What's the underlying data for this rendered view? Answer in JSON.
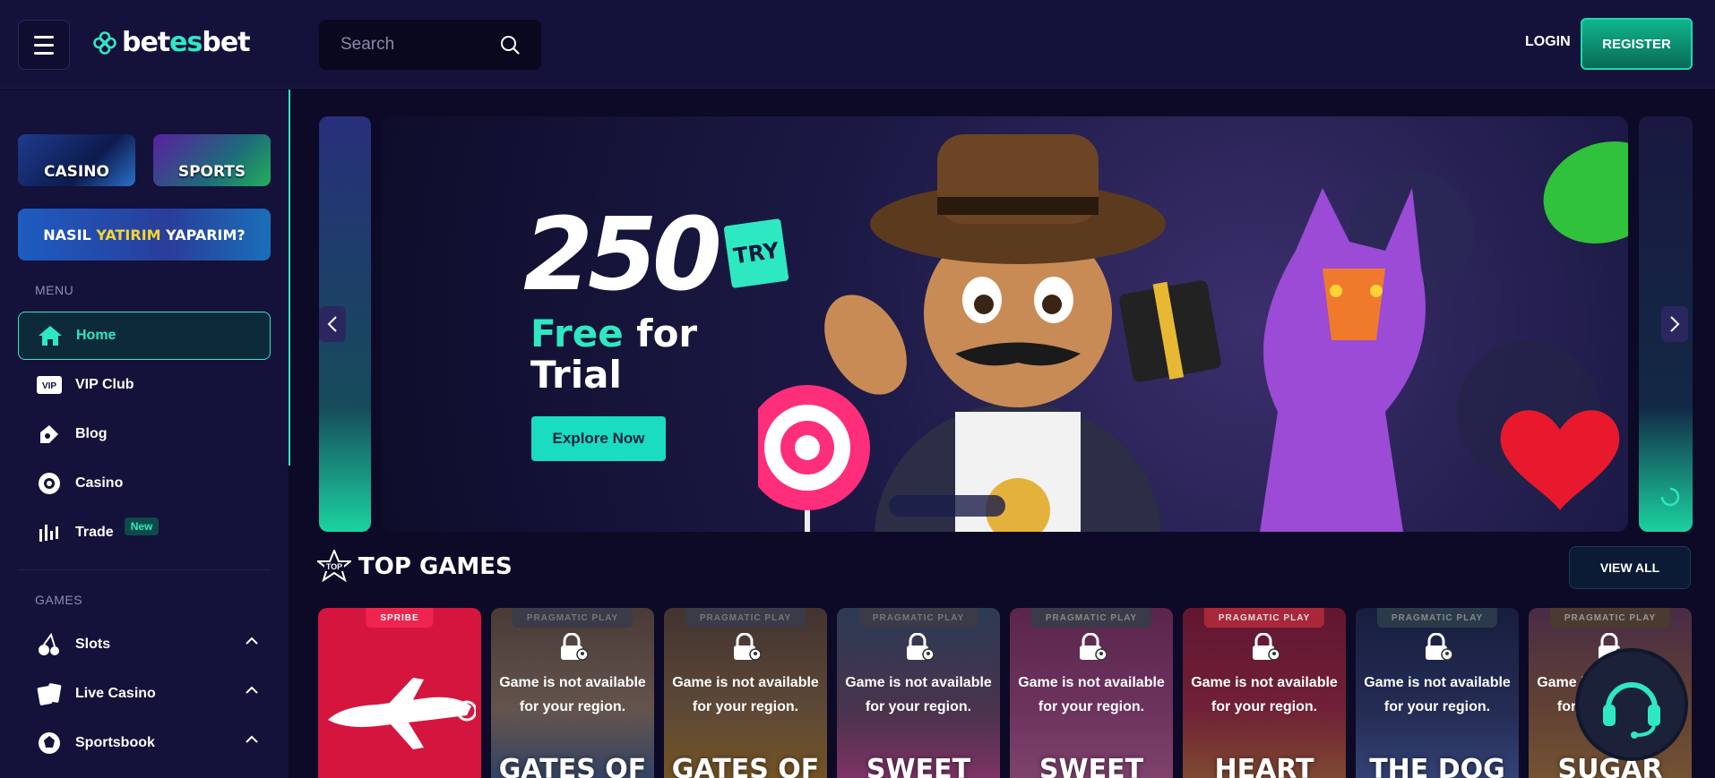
{
  "header": {
    "logo_prefix": "bet",
    "logo_accent": "es",
    "logo_suffix": "bet",
    "search_placeholder": "Search",
    "login_label": "LOGIN",
    "register_label": "REGISTER"
  },
  "sidebar": {
    "promos": {
      "casino": "CASINO",
      "sports": "SPORTS",
      "yatirim_prefix": "NASIL",
      "yatirim_accent": "YATIRIM",
      "yatirim_suffix": "YAPARIM?"
    },
    "menu_label": "MENU",
    "menu": [
      {
        "label": "Home",
        "icon": "home-icon",
        "active": true
      },
      {
        "label": "VIP Club",
        "icon": "vip-icon"
      },
      {
        "label": "Blog",
        "icon": "blog-icon"
      },
      {
        "label": "Casino",
        "icon": "casino-chip-icon"
      },
      {
        "label": "Trade",
        "icon": "trade-chart-icon",
        "badge": "New"
      }
    ],
    "games_label": "GAMES",
    "games": [
      {
        "label": "Slots",
        "icon": "cherries-icon"
      },
      {
        "label": "Live Casino",
        "icon": "cards-icon"
      },
      {
        "label": "Sportsbook",
        "icon": "sportsbook-icon"
      }
    ]
  },
  "banner": {
    "amount": "250",
    "currency": "TRY",
    "line1_accent": "Free",
    "line1_rest": " for",
    "line2": "Trial",
    "cta": "Explore Now"
  },
  "top_games": {
    "title": "TOP GAMES",
    "view_all": "VIEW ALL",
    "unavailable_line1": "Game is not available",
    "unavailable_line2": "for your region.",
    "cards": [
      {
        "provider": "SPRIBE",
        "locked": false,
        "title": ""
      },
      {
        "provider": "PRAGMATIC PLAY",
        "locked": true,
        "title": "GATES OF"
      },
      {
        "provider": "PRAGMATIC PLAY",
        "locked": true,
        "title": "GATES OF"
      },
      {
        "provider": "PRAGMATIC PLAY",
        "locked": true,
        "title": "SWEET"
      },
      {
        "provider": "PRAGMATIC PLAY",
        "locked": true,
        "title": "SWEET"
      },
      {
        "provider": "PRAGMATIC PLAY",
        "locked": true,
        "title": "HEART"
      },
      {
        "provider": "PRAGMATIC PLAY",
        "locked": true,
        "title": "THE DOG"
      },
      {
        "provider": "PRAGMATIC PLAY",
        "locked": true,
        "title": "SUGAR"
      }
    ]
  },
  "colors": {
    "accent": "#2ee8c2",
    "background": "#0c0a26",
    "panel": "#14113a"
  }
}
